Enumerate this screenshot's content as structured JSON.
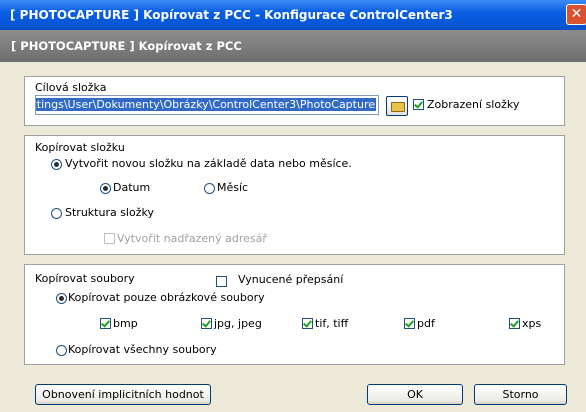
{
  "window": {
    "title": "[ PHOTOCAPTURE ]  Kopírovat z PCC - Konfigurace ControlCenter3",
    "close_icon": "close-icon"
  },
  "header": {
    "title": "[ PHOTOCAPTURE ]  Kopírovat z PCC"
  },
  "destination": {
    "label": "Cílová složka",
    "path": "ttings\\User\\Dokumenty\\Obrázky\\ControlCenter3\\PhotoCapture",
    "browse_icon": "folder-icon",
    "show_folder_label": "Zobrazení složky",
    "show_folder_checked": true
  },
  "copy_folder": {
    "label": "Kopírovat složku",
    "option_new_folder": "Vytvořit novou složku na základě data nebo měsíce.",
    "option_new_folder_selected": true,
    "by_date": "Datum",
    "by_date_selected": true,
    "by_month": "Měsíc",
    "by_month_selected": false,
    "option_structure": "Struktura složky",
    "option_structure_selected": false,
    "create_parent": "Vytvořit nadřazený adresář",
    "create_parent_checked": false
  },
  "copy_files": {
    "label": "Kopírovat soubory",
    "force_overwrite": "Vynucené přepsání",
    "force_overwrite_checked": false,
    "option_images_only": "Kopírovat pouze obrázkové soubory",
    "option_images_only_selected": true,
    "types": [
      {
        "label": "bmp",
        "checked": true
      },
      {
        "label": "jpg, jpeg",
        "checked": true
      },
      {
        "label": "tif, tiff",
        "checked": true
      },
      {
        "label": "pdf",
        "checked": true
      },
      {
        "label": "xps",
        "checked": true
      }
    ],
    "option_all": "Kopírovat všechny soubory",
    "option_all_selected": false
  },
  "footer": {
    "restore_defaults": "Obnovení implicitních hodnot",
    "ok": "OK",
    "cancel": "Storno"
  },
  "colors": {
    "titlebar": "#0a5ee3",
    "header": "#7a7a7a",
    "dialog_bg": "#ece9d8",
    "selection": "#316ac5"
  }
}
